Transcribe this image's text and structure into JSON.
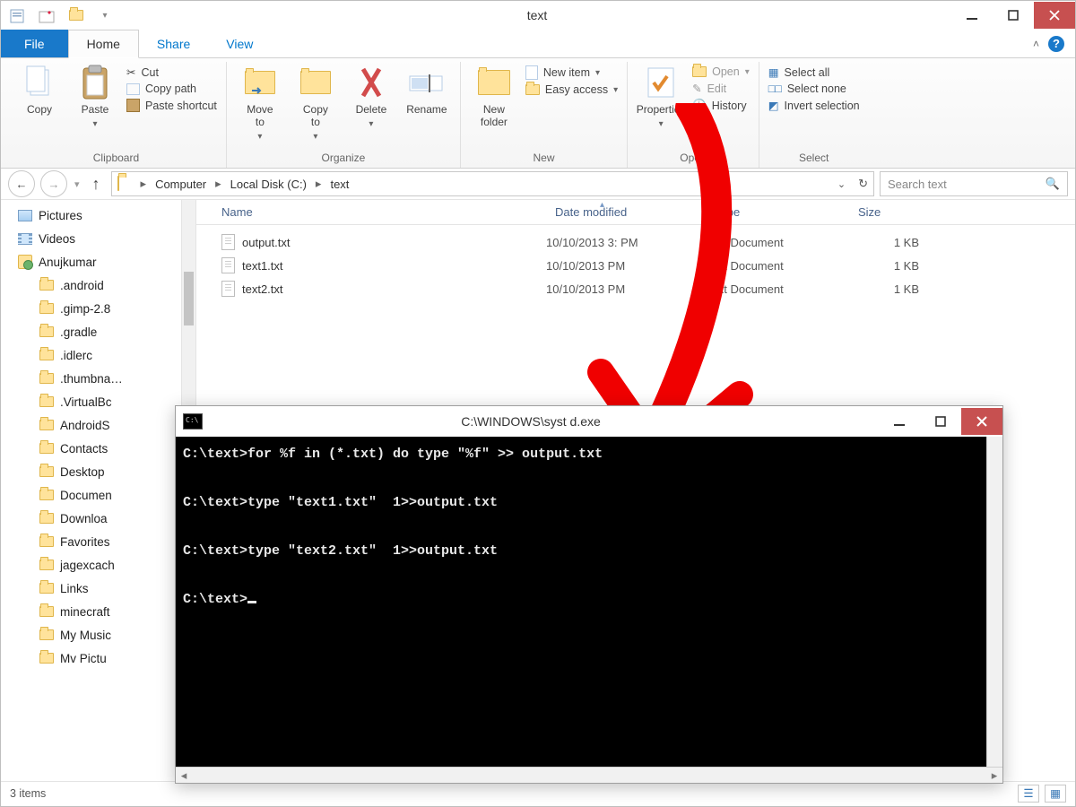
{
  "explorer": {
    "title": "text",
    "tabs": {
      "file": "File",
      "home": "Home",
      "share": "Share",
      "view": "View"
    },
    "ribbon": {
      "clipboard": {
        "label": "Clipboard",
        "copy": "Copy",
        "paste": "Paste",
        "cut": "Cut",
        "copy_path": "Copy path",
        "paste_shortcut": "Paste shortcut"
      },
      "organize": {
        "label": "Organize",
        "move_to": "Move\nto",
        "copy_to": "Copy\nto",
        "delete": "Delete",
        "rename": "Rename"
      },
      "new": {
        "label": "New",
        "new_folder": "New\nfolder",
        "new_item": "New item",
        "easy_access": "Easy access"
      },
      "open": {
        "label": "Open",
        "properties": "Properties",
        "open": "Open",
        "edit": "Edit",
        "history": "History"
      },
      "select": {
        "label": "Select",
        "all": "Select all",
        "none": "Select none",
        "invert": "Invert selection"
      }
    },
    "address": {
      "crumbs": [
        "Computer",
        "Local Disk (C:)",
        "text"
      ]
    },
    "search_placeholder": "Search text",
    "columns": [
      "Name",
      "Date modified",
      "Type",
      "Size"
    ],
    "files": [
      {
        "name": "output.txt",
        "date": "10/10/2013 3:   PM",
        "type": "Text Document",
        "size": "1 KB"
      },
      {
        "name": "text1.txt",
        "date": "10/10/2013     PM",
        "type": "Text Document",
        "size": "1 KB"
      },
      {
        "name": "text2.txt",
        "date": "10/10/2013      PM",
        "type": "Text Document",
        "size": "1 KB"
      }
    ],
    "tree": [
      {
        "label": "Pictures",
        "icon": "pict",
        "indent": false
      },
      {
        "label": "Videos",
        "icon": "vid",
        "indent": false
      },
      {
        "label": "Anujkumar",
        "icon": "user",
        "indent": false
      },
      {
        "label": ".android",
        "icon": "folder",
        "indent": true
      },
      {
        "label": ".gimp-2.8",
        "icon": "folder",
        "indent": true
      },
      {
        "label": ".gradle",
        "icon": "folder",
        "indent": true
      },
      {
        "label": ".idlerc",
        "icon": "folder",
        "indent": true
      },
      {
        "label": ".thumbna…",
        "icon": "folder",
        "indent": true
      },
      {
        "label": ".VirtualBc",
        "icon": "folder",
        "indent": true
      },
      {
        "label": "AndroidS",
        "icon": "folder",
        "indent": true
      },
      {
        "label": "Contacts",
        "icon": "folder",
        "indent": true
      },
      {
        "label": "Desktop",
        "icon": "folder",
        "indent": true
      },
      {
        "label": "Documen",
        "icon": "folder",
        "indent": true
      },
      {
        "label": "Downloa",
        "icon": "folder",
        "indent": true
      },
      {
        "label": "Favorites",
        "icon": "folder",
        "indent": true
      },
      {
        "label": "jagexcach",
        "icon": "folder",
        "indent": true
      },
      {
        "label": "Links",
        "icon": "folder",
        "indent": true
      },
      {
        "label": "minecraft",
        "icon": "folder",
        "indent": true
      },
      {
        "label": "My Music",
        "icon": "folder",
        "indent": true
      },
      {
        "label": "Mv Pictu",
        "icon": "folder",
        "indent": true
      }
    ],
    "status": "3 items"
  },
  "cmd": {
    "title": "C:\\WINDOWS\\syst            d.exe",
    "lines": [
      "C:\\text>for %f in (*.txt) do type \"%f\" >> output.txt",
      "",
      "C:\\text>type \"text1.txt\"  1>>output.txt",
      "",
      "C:\\text>type \"text2.txt\"  1>>output.txt",
      "",
      "C:\\text>"
    ]
  }
}
